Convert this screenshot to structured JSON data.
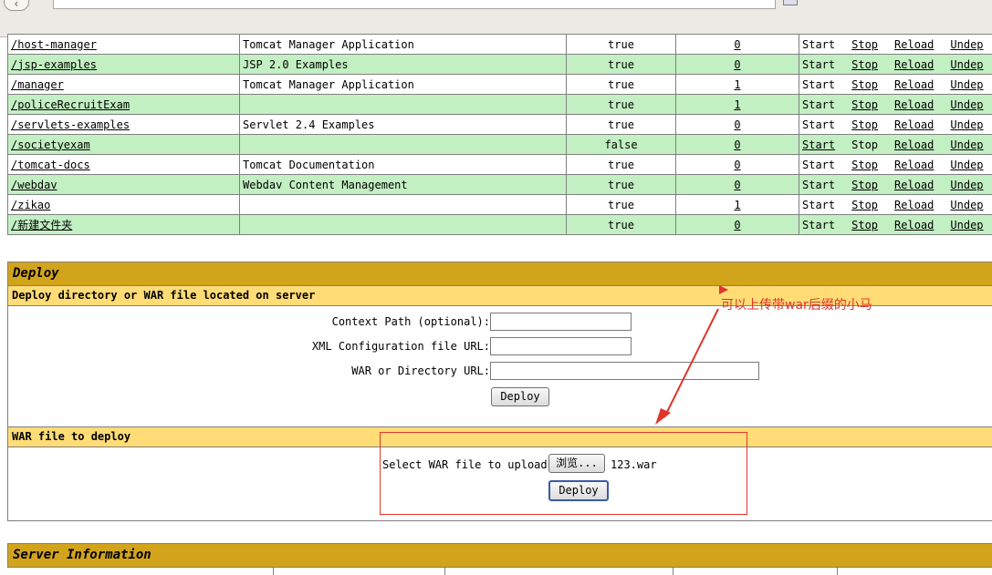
{
  "browser": {
    "nav_icon": "back-arrow-icon"
  },
  "apps": [
    {
      "path": "/host-manager",
      "name": "Tomcat Manager Application",
      "running": "true",
      "sessions": "0",
      "actions": [
        "Start",
        "Stop",
        "Reload",
        "Undep"
      ]
    },
    {
      "path": "/jsp-examples",
      "name": "JSP 2.0 Examples",
      "running": "true",
      "sessions": "0",
      "actions": [
        "Start",
        "Stop",
        "Reload",
        "Undep"
      ]
    },
    {
      "path": "/manager",
      "name": "Tomcat Manager Application",
      "running": "true",
      "sessions": "1",
      "actions": [
        "Start",
        "Stop",
        "Reload",
        "Undep"
      ]
    },
    {
      "path": "/policeRecruitExam",
      "name": "",
      "running": "true",
      "sessions": "1",
      "actions": [
        "Start",
        "Stop",
        "Reload",
        "Undep"
      ]
    },
    {
      "path": "/servlets-examples",
      "name": "Servlet 2.4 Examples",
      "running": "true",
      "sessions": "0",
      "actions": [
        "Start",
        "Stop",
        "Reload",
        "Undep"
      ]
    },
    {
      "path": "/societyexam",
      "name": "",
      "running": "false",
      "sessions": "0",
      "actions": [
        "Start",
        "Stop",
        "Reload",
        "Undep"
      ]
    },
    {
      "path": "/tomcat-docs",
      "name": "Tomcat Documentation",
      "running": "true",
      "sessions": "0",
      "actions": [
        "Start",
        "Stop",
        "Reload",
        "Undep"
      ]
    },
    {
      "path": "/webdav",
      "name": "Webdav Content Management",
      "running": "true",
      "sessions": "0",
      "actions": [
        "Start",
        "Stop",
        "Reload",
        "Undep"
      ]
    },
    {
      "path": "/zikao",
      "name": "",
      "running": "true",
      "sessions": "1",
      "actions": [
        "Start",
        "Stop",
        "Reload",
        "Undep"
      ]
    },
    {
      "path": "/新建文件夹",
      "name": "",
      "running": "true",
      "sessions": "0",
      "actions": [
        "Start",
        "Stop",
        "Reload",
        "Undep"
      ]
    }
  ],
  "deploy": {
    "title": "Deploy",
    "server_section": "Deploy directory or WAR file located on server",
    "context_path_label": "Context Path (optional):",
    "xml_config_label": "XML Configuration file URL:",
    "war_dir_label": "WAR or Directory URL:",
    "deploy_button": "Deploy",
    "war_section": "WAR file to deploy",
    "select_label": "Select WAR file to upload",
    "browse_button": "浏览...",
    "selected_file": "123.war",
    "upload_button": "Deploy"
  },
  "annotation": {
    "text": "可以上传带war后缀的小马",
    "color": "#e0362c"
  },
  "server_info": {
    "title": "Server Information"
  }
}
